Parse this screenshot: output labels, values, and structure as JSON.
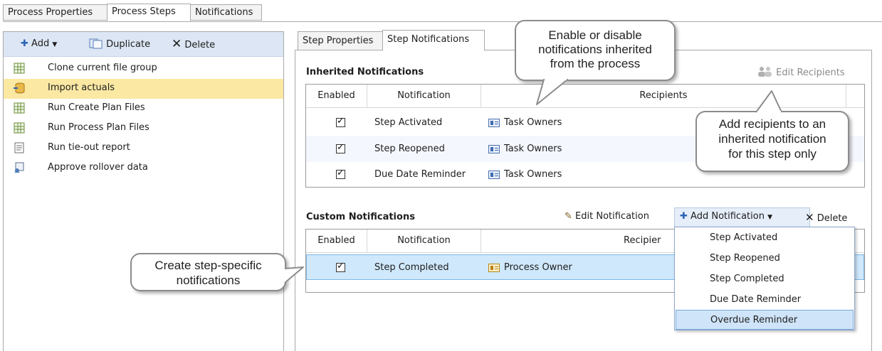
{
  "top_tabs": [
    "Process Properties",
    "Process Steps",
    "Notifications"
  ],
  "left_toolbar": {
    "add": "Add",
    "duplicate": "Duplicate",
    "delete": "Delete"
  },
  "steps": [
    {
      "label": "Clone current file group",
      "icon": "grid-doc-icon"
    },
    {
      "label": "Import actuals",
      "icon": "database-import-icon",
      "selected": true
    },
    {
      "label": "Run Create Plan Files",
      "icon": "grid-doc-icon"
    },
    {
      "label": "Run Process Plan Files",
      "icon": "grid-doc-icon"
    },
    {
      "label": "Run tie-out report",
      "icon": "report-doc-icon"
    },
    {
      "label": "Approve rollover data",
      "icon": "approve-icon"
    }
  ],
  "sub_tabs": [
    "Step Properties",
    "Step Notifications"
  ],
  "inherited": {
    "title": "Inherited Notifications",
    "edit_recipients": "Edit Recipients",
    "columns": [
      "Enabled",
      "Notification",
      "Recipients"
    ],
    "rows": [
      {
        "enabled": true,
        "notification": "Step Activated",
        "recipients": "Task Owners"
      },
      {
        "enabled": true,
        "notification": "Step Reopened",
        "recipients": "Task Owners"
      },
      {
        "enabled": true,
        "notification": "Due Date Reminder",
        "recipients": "Task Owners"
      }
    ]
  },
  "custom": {
    "title": "Custom Notifications",
    "edit_notification": "Edit Notification",
    "add_notification": "Add Notification",
    "delete": "Delete",
    "columns": [
      "Enabled",
      "Notification",
      "Recipier"
    ],
    "rows": [
      {
        "enabled": true,
        "notification": "Step Completed",
        "recipients": "Process Owner"
      }
    ]
  },
  "dropdown_items": [
    "Step Activated",
    "Step Reopened",
    "Step Completed",
    "Due Date Reminder",
    "Overdue Reminder"
  ],
  "callouts": {
    "enable_disable": [
      "Enable or disable",
      "notifications inherited",
      "from the process"
    ],
    "add_recipients": [
      "Add recipients to an",
      "inherited notification",
      "for this step only"
    ],
    "create_step": [
      "Create step-specific",
      "notifications"
    ]
  },
  "colors": {
    "selected_step": "#fbe8a3",
    "toolbar_bg": "#dce6f4",
    "selected_row": "#cfe8fb",
    "accent": "#2c63b5"
  }
}
